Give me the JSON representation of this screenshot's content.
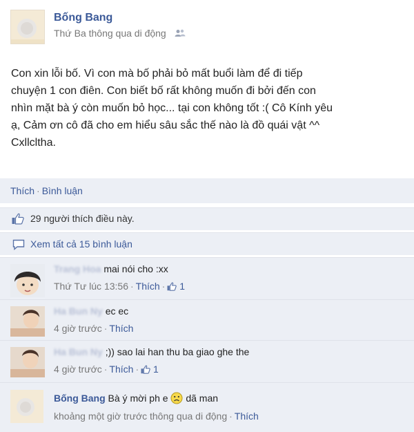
{
  "post": {
    "author": "Bống Bang",
    "meta": "Thứ Ba thông qua di động",
    "meta_icon": "friends-icon",
    "text": "Con xin lỗi bố. Vì con mà bố phải bỏ mất buổi làm để đi tiếp\nchuyện 1 con điên. Con biết bố rất không muốn đi bởi đến con\nnhìn mặt bà ý còn muốn bỏ học... tại con không tốt :( Cô Kính yêu\nạ, Cảm ơn cô đã cho em hiểu sâu sắc thế nào là đồ quái vật ^^\nCxllcltha."
  },
  "actions": {
    "like": "Thích",
    "sep": "·",
    "comment": "Bình luận"
  },
  "likes": {
    "text": "29 người thích điều này.",
    "icon": "thumbs-up-icon"
  },
  "view_all": {
    "text": "Xem tất cả 15 bình luận",
    "icon": "comment-icon"
  },
  "comments": [
    {
      "name": "Trang Hoa",
      "text": "mai nói cho :xx",
      "time": "Thứ Tư lúc 13:56",
      "like": "Thích",
      "likes": "1"
    },
    {
      "name": "Ha Bun Ny",
      "text": "ec ec",
      "time": "4 giờ trước",
      "like": "Thích"
    },
    {
      "name": "Ha Bun Ny",
      "text": ";)) sao lai han thu ba giao ghe the",
      "time": "4 giờ trước",
      "like": "Thích",
      "likes": "1"
    },
    {
      "name": "Bống Bang",
      "text_before": "Bà ý mời ph e",
      "emoticon": "frown-emoticon",
      "text_after": "dã man",
      "time": "khoảng một giờ trước thông qua di động",
      "like": "Thích"
    }
  ],
  "colors": {
    "link": "#3b5998",
    "panel": "#eceff5",
    "muted": "#777777"
  }
}
